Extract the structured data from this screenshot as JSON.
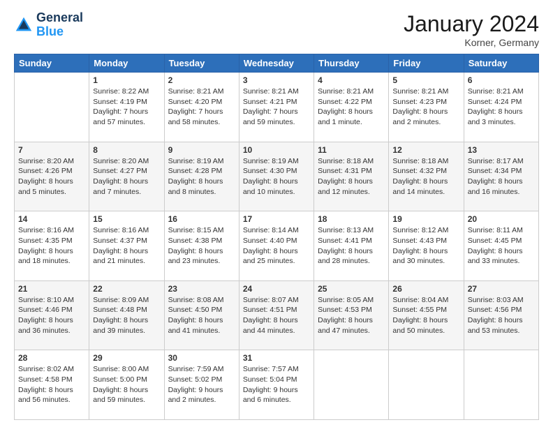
{
  "header": {
    "logo_line1": "General",
    "logo_line2": "Blue",
    "month": "January 2024",
    "location": "Korner, Germany"
  },
  "weekdays": [
    "Sunday",
    "Monday",
    "Tuesday",
    "Wednesday",
    "Thursday",
    "Friday",
    "Saturday"
  ],
  "weeks": [
    [
      {
        "day": "",
        "sunrise": "",
        "sunset": "",
        "daylight": ""
      },
      {
        "day": "1",
        "sunrise": "Sunrise: 8:22 AM",
        "sunset": "Sunset: 4:19 PM",
        "daylight": "Daylight: 7 hours and 57 minutes."
      },
      {
        "day": "2",
        "sunrise": "Sunrise: 8:21 AM",
        "sunset": "Sunset: 4:20 PM",
        "daylight": "Daylight: 7 hours and 58 minutes."
      },
      {
        "day": "3",
        "sunrise": "Sunrise: 8:21 AM",
        "sunset": "Sunset: 4:21 PM",
        "daylight": "Daylight: 7 hours and 59 minutes."
      },
      {
        "day": "4",
        "sunrise": "Sunrise: 8:21 AM",
        "sunset": "Sunset: 4:22 PM",
        "daylight": "Daylight: 8 hours and 1 minute."
      },
      {
        "day": "5",
        "sunrise": "Sunrise: 8:21 AM",
        "sunset": "Sunset: 4:23 PM",
        "daylight": "Daylight: 8 hours and 2 minutes."
      },
      {
        "day": "6",
        "sunrise": "Sunrise: 8:21 AM",
        "sunset": "Sunset: 4:24 PM",
        "daylight": "Daylight: 8 hours and 3 minutes."
      }
    ],
    [
      {
        "day": "7",
        "sunrise": "Sunrise: 8:20 AM",
        "sunset": "Sunset: 4:26 PM",
        "daylight": "Daylight: 8 hours and 5 minutes."
      },
      {
        "day": "8",
        "sunrise": "Sunrise: 8:20 AM",
        "sunset": "Sunset: 4:27 PM",
        "daylight": "Daylight: 8 hours and 7 minutes."
      },
      {
        "day": "9",
        "sunrise": "Sunrise: 8:19 AM",
        "sunset": "Sunset: 4:28 PM",
        "daylight": "Daylight: 8 hours and 8 minutes."
      },
      {
        "day": "10",
        "sunrise": "Sunrise: 8:19 AM",
        "sunset": "Sunset: 4:30 PM",
        "daylight": "Daylight: 8 hours and 10 minutes."
      },
      {
        "day": "11",
        "sunrise": "Sunrise: 8:18 AM",
        "sunset": "Sunset: 4:31 PM",
        "daylight": "Daylight: 8 hours and 12 minutes."
      },
      {
        "day": "12",
        "sunrise": "Sunrise: 8:18 AM",
        "sunset": "Sunset: 4:32 PM",
        "daylight": "Daylight: 8 hours and 14 minutes."
      },
      {
        "day": "13",
        "sunrise": "Sunrise: 8:17 AM",
        "sunset": "Sunset: 4:34 PM",
        "daylight": "Daylight: 8 hours and 16 minutes."
      }
    ],
    [
      {
        "day": "14",
        "sunrise": "Sunrise: 8:16 AM",
        "sunset": "Sunset: 4:35 PM",
        "daylight": "Daylight: 8 hours and 18 minutes."
      },
      {
        "day": "15",
        "sunrise": "Sunrise: 8:16 AM",
        "sunset": "Sunset: 4:37 PM",
        "daylight": "Daylight: 8 hours and 21 minutes."
      },
      {
        "day": "16",
        "sunrise": "Sunrise: 8:15 AM",
        "sunset": "Sunset: 4:38 PM",
        "daylight": "Daylight: 8 hours and 23 minutes."
      },
      {
        "day": "17",
        "sunrise": "Sunrise: 8:14 AM",
        "sunset": "Sunset: 4:40 PM",
        "daylight": "Daylight: 8 hours and 25 minutes."
      },
      {
        "day": "18",
        "sunrise": "Sunrise: 8:13 AM",
        "sunset": "Sunset: 4:41 PM",
        "daylight": "Daylight: 8 hours and 28 minutes."
      },
      {
        "day": "19",
        "sunrise": "Sunrise: 8:12 AM",
        "sunset": "Sunset: 4:43 PM",
        "daylight": "Daylight: 8 hours and 30 minutes."
      },
      {
        "day": "20",
        "sunrise": "Sunrise: 8:11 AM",
        "sunset": "Sunset: 4:45 PM",
        "daylight": "Daylight: 8 hours and 33 minutes."
      }
    ],
    [
      {
        "day": "21",
        "sunrise": "Sunrise: 8:10 AM",
        "sunset": "Sunset: 4:46 PM",
        "daylight": "Daylight: 8 hours and 36 minutes."
      },
      {
        "day": "22",
        "sunrise": "Sunrise: 8:09 AM",
        "sunset": "Sunset: 4:48 PM",
        "daylight": "Daylight: 8 hours and 39 minutes."
      },
      {
        "day": "23",
        "sunrise": "Sunrise: 8:08 AM",
        "sunset": "Sunset: 4:50 PM",
        "daylight": "Daylight: 8 hours and 41 minutes."
      },
      {
        "day": "24",
        "sunrise": "Sunrise: 8:07 AM",
        "sunset": "Sunset: 4:51 PM",
        "daylight": "Daylight: 8 hours and 44 minutes."
      },
      {
        "day": "25",
        "sunrise": "Sunrise: 8:05 AM",
        "sunset": "Sunset: 4:53 PM",
        "daylight": "Daylight: 8 hours and 47 minutes."
      },
      {
        "day": "26",
        "sunrise": "Sunrise: 8:04 AM",
        "sunset": "Sunset: 4:55 PM",
        "daylight": "Daylight: 8 hours and 50 minutes."
      },
      {
        "day": "27",
        "sunrise": "Sunrise: 8:03 AM",
        "sunset": "Sunset: 4:56 PM",
        "daylight": "Daylight: 8 hours and 53 minutes."
      }
    ],
    [
      {
        "day": "28",
        "sunrise": "Sunrise: 8:02 AM",
        "sunset": "Sunset: 4:58 PM",
        "daylight": "Daylight: 8 hours and 56 minutes."
      },
      {
        "day": "29",
        "sunrise": "Sunrise: 8:00 AM",
        "sunset": "Sunset: 5:00 PM",
        "daylight": "Daylight: 8 hours and 59 minutes."
      },
      {
        "day": "30",
        "sunrise": "Sunrise: 7:59 AM",
        "sunset": "Sunset: 5:02 PM",
        "daylight": "Daylight: 9 hours and 2 minutes."
      },
      {
        "day": "31",
        "sunrise": "Sunrise: 7:57 AM",
        "sunset": "Sunset: 5:04 PM",
        "daylight": "Daylight: 9 hours and 6 minutes."
      },
      {
        "day": "",
        "sunrise": "",
        "sunset": "",
        "daylight": ""
      },
      {
        "day": "",
        "sunrise": "",
        "sunset": "",
        "daylight": ""
      },
      {
        "day": "",
        "sunrise": "",
        "sunset": "",
        "daylight": ""
      }
    ]
  ]
}
